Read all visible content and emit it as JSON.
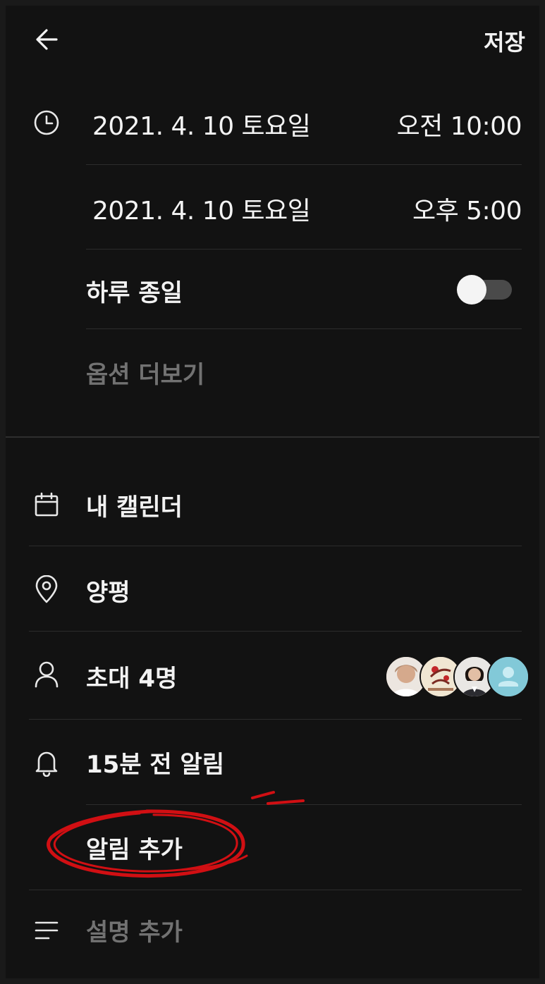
{
  "header": {
    "back_icon": "arrow-left-icon",
    "save_label": "저장"
  },
  "schedule": {
    "start": {
      "date": "2021. 4. 10 토요일",
      "time": "오전 10:00"
    },
    "end": {
      "date": "2021. 4. 10 토요일",
      "time": "오후 5:00"
    },
    "all_day_label": "하루 종일",
    "all_day_enabled": false,
    "more_options_label": "옵션 더보기"
  },
  "details": {
    "calendar_label": "내 캘린더",
    "location_label": "양평",
    "invite_label": "초대 4명",
    "alarm_label": "15분 전 알림",
    "add_alarm_label": "알림 추가",
    "description_placeholder": "설명 추가"
  },
  "avatars": [
    {
      "name": "avatar-1",
      "color": "#d8b9a8"
    },
    {
      "name": "avatar-2",
      "color": "#e9d9c0"
    },
    {
      "name": "avatar-3",
      "color": "#d9d3cc"
    },
    {
      "name": "avatar-4",
      "color": "#7cc6d6"
    }
  ],
  "annotation_color": "#d10f13"
}
